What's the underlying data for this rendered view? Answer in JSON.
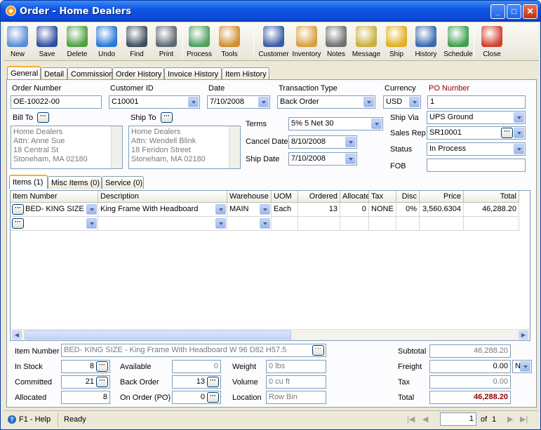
{
  "window": {
    "title": "Order - Home Dealers"
  },
  "toolbar": [
    {
      "id": "new",
      "label": "New",
      "icon": "new-icon",
      "color": "#5a8ed8"
    },
    {
      "id": "save",
      "label": "Save",
      "icon": "floppy-icon",
      "color": "#3050a0"
    },
    {
      "id": "delete",
      "label": "Delete",
      "icon": "trash-icon",
      "color": "#50a040"
    },
    {
      "id": "undo",
      "label": "Undo",
      "icon": "undo-arrow-icon",
      "color": "#2a78d8"
    },
    {
      "id": "find",
      "label": "Find",
      "icon": "binoculars-icon",
      "color": "#405060"
    },
    {
      "id": "print",
      "label": "Print",
      "icon": "printer-icon",
      "color": "#606870"
    },
    {
      "id": "process",
      "label": "Process",
      "icon": "process-icon",
      "color": "#50a060"
    },
    {
      "id": "tools",
      "label": "Tools",
      "icon": "tools-icon",
      "color": "#d09030"
    },
    {
      "id": "customer",
      "label": "Customer",
      "icon": "customer-icon",
      "color": "#3a5ca8"
    },
    {
      "id": "inventory",
      "label": "Inventory",
      "icon": "boxes-icon",
      "color": "#d8a040"
    },
    {
      "id": "notes",
      "label": "Notes",
      "icon": "notes-icon",
      "color": "#707070"
    },
    {
      "id": "message",
      "label": "Message",
      "icon": "message-icon",
      "color": "#c8b040"
    },
    {
      "id": "ship",
      "label": "Ship",
      "icon": "forklift-icon",
      "color": "#e0b020"
    },
    {
      "id": "history",
      "label": "History",
      "icon": "history-icon",
      "color": "#3a6ab0"
    },
    {
      "id": "schedule",
      "label": "Schedule",
      "icon": "schedule-icon",
      "color": "#40a050"
    },
    {
      "id": "close",
      "label": "Close",
      "icon": "close-doc-icon",
      "color": "#d04030"
    }
  ],
  "tabs": [
    "General",
    "Detail",
    "Commission",
    "Order History",
    "Invoice History",
    "Item History"
  ],
  "form": {
    "order_number_label": "Order Number",
    "order_number": "OE-10022-00",
    "customer_id_label": "Customer ID",
    "customer_id": "C10001",
    "date_label": "Date",
    "date": "7/10/2008",
    "transaction_type_label": "Transaction Type",
    "transaction_type": "Back Order",
    "currency_label": "Currency",
    "currency": "USD",
    "po_number_label": "PO Number",
    "po_number": "1",
    "bill_to_label": "Bill To",
    "bill_to": [
      "Home Dealers",
      "Attn: Anne Sue",
      "18 Central St",
      "Stoneham, MA 02180"
    ],
    "ship_to_label": "Ship To",
    "ship_to": [
      "Home Dealers",
      "Attn: Wendell Blink",
      "18 Feridon Street",
      "Stoneham, MA 02180"
    ],
    "terms_label": "Terms",
    "terms": "5% 5 Net 30",
    "cancel_date_label": "Cancel Date",
    "cancel_date": "8/10/2008",
    "ship_date_label": "Ship Date",
    "ship_date": "7/10/2008",
    "ship_via_label": "Ship Via",
    "ship_via": "UPS Ground",
    "sales_rep_label": "Sales Rep",
    "sales_rep": "SR10001",
    "status_label": "Status",
    "status": "In Process",
    "fob_label": "FOB",
    "fob": ""
  },
  "subtabs": [
    "Items (1)",
    "Misc Items (0)",
    "Service (0)"
  ],
  "grid": {
    "columns": [
      "Item Number",
      "Description",
      "Warehouse",
      "UOM",
      "Ordered",
      "Allocate",
      "Tax",
      "Disc",
      "Price",
      "Total"
    ],
    "rows": [
      [
        "BED- KING SIZE",
        "King Frame With  Headboard",
        "MAIN",
        "Each",
        "13",
        "0",
        "NONE",
        "0%",
        "3,560.6304",
        "46,288.20"
      ]
    ]
  },
  "bottom": {
    "item_number_label": "Item Number",
    "item_number": "BED- KING SIZE - King Frame With  Headboard W 96 D82  H57.5",
    "in_stock_label": "In Stock",
    "in_stock": "8",
    "committed_label": "Committed",
    "committed": "21",
    "allocated_label": "Allocated",
    "allocated": "8",
    "available_label": "Available",
    "available": "0",
    "back_order_label": "Back Order",
    "back_order": "13",
    "on_order_label": "On Order (PO)",
    "on_order": "0",
    "weight_label": "Weight",
    "weight": "0 lbs",
    "volume_label": "Volume",
    "volume": "0 cu ft",
    "location_label": "Location",
    "location": "Row  Bin",
    "subtotal_label": "Subtotal",
    "subtotal": "46,288.20",
    "freight_label": "Freight",
    "freight": "0.00",
    "freight_code": "N",
    "tax_label": "Tax",
    "tax": "0.00",
    "total_label": "Total",
    "total": "46,288.20"
  },
  "status": {
    "help": "F1 - Help",
    "state": "Ready",
    "page": "1",
    "of_label": "of",
    "page_count": "1"
  },
  "colors": {
    "title_bar": "#0a4ad8",
    "po_label": "#a00000",
    "total_value": "#8a0000"
  }
}
